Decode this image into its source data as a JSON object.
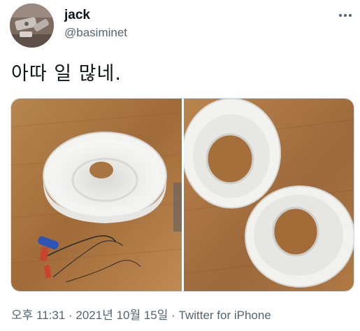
{
  "tweet": {
    "display_name": "jack",
    "handle": "@basiminet",
    "text": "아따 일 많네.",
    "more_icon": "more-horizontal-icon",
    "timestamp": "오후 11:31 · 2021년 10월 15일",
    "separator": " · ",
    "source": "Twitter for iPhone"
  },
  "media": {
    "photos": [
      {
        "name": "photo-left",
        "description_icon": "photo"
      },
      {
        "name": "photo-right",
        "description_icon": "photo"
      }
    ]
  },
  "colors": {
    "text_primary": "#0f1419",
    "text_secondary": "#536471",
    "border": "#cfd9de",
    "floor_wood": "#a8743f"
  }
}
